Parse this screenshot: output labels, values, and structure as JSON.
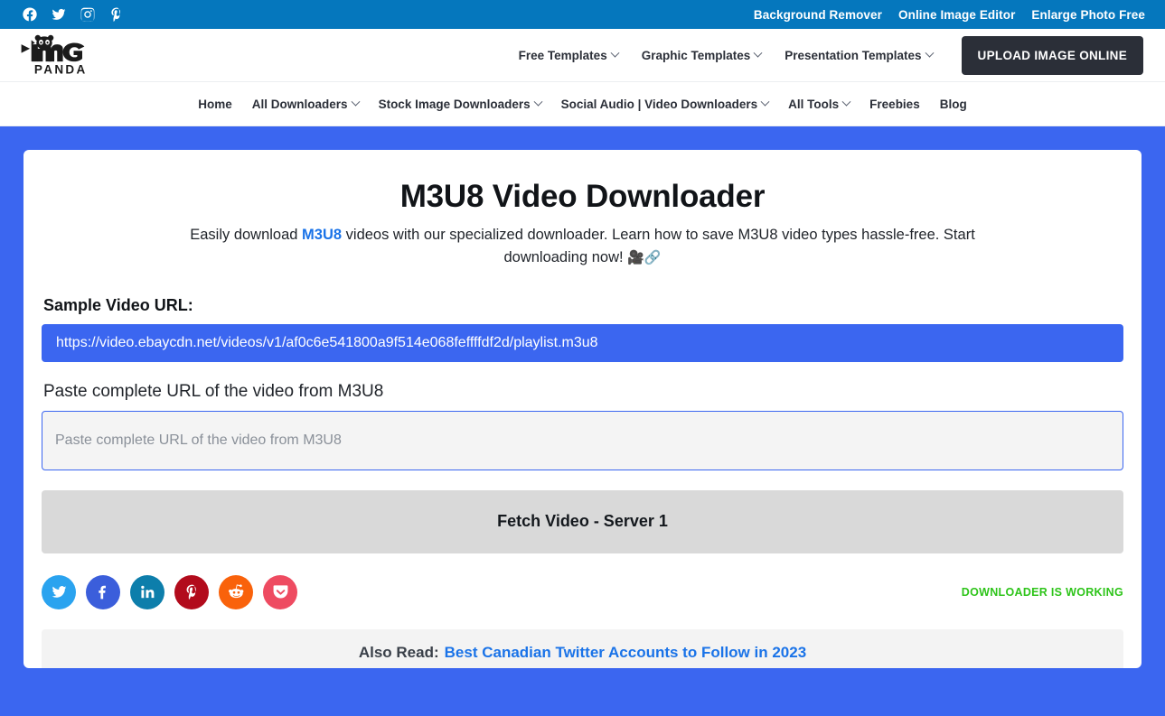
{
  "topbar": {
    "social_icons": [
      {
        "name": "facebook-icon",
        "label": "Facebook"
      },
      {
        "name": "twitter-icon",
        "label": "Twitter"
      },
      {
        "name": "instagram-icon",
        "label": "Instagram"
      },
      {
        "name": "pinterest-icon",
        "label": "Pinterest"
      }
    ],
    "links": [
      {
        "label": "Background Remover"
      },
      {
        "label": "Online Image Editor"
      },
      {
        "label": "Enlarge Photo Free"
      }
    ],
    "bg_color": "#0577BD"
  },
  "header": {
    "logo_text": "IMG PANDA",
    "nav": [
      {
        "label": "Free Templates",
        "has_caret": true
      },
      {
        "label": "Graphic Templates",
        "has_caret": true
      },
      {
        "label": "Presentation Templates",
        "has_caret": true
      }
    ],
    "upload_button": "UPLOAD IMAGE ONLINE"
  },
  "subnav": {
    "items": [
      {
        "label": "Home",
        "has_caret": false
      },
      {
        "label": "All Downloaders",
        "has_caret": true
      },
      {
        "label": "Stock Image Downloaders",
        "has_caret": true
      },
      {
        "label": "Social Audio | Video Downloaders",
        "has_caret": true
      },
      {
        "label": "All Tools",
        "has_caret": true
      },
      {
        "label": "Freebies",
        "has_caret": false
      },
      {
        "label": "Blog",
        "has_caret": false
      }
    ]
  },
  "main": {
    "title": "M3U8 Video Downloader",
    "subtitle_part1": "Easily download ",
    "subtitle_highlight": "M3U8",
    "subtitle_part2": " videos with our specialized downloader. Learn how to save M3U8 video types hassle-free. Start downloading now! ",
    "subtitle_emoji": "🎥🔗",
    "sample_label": "Sample Video URL:",
    "sample_url": "https://video.ebaycdn.net/videos/v1/af0c6e541800a9f514e068feffffdf2d/playlist.m3u8",
    "paste_label": "Paste complete URL of the video from M3U8",
    "input_placeholder": "Paste complete URL of the video from M3U8",
    "input_value": "",
    "fetch_button": "Fetch Video - Server 1",
    "status_text": "DOWNLOADER IS WORKING",
    "status_color": "#2EC41A",
    "also_read_label": "Also Read:",
    "also_read_link": "Best Canadian Twitter Accounts to Follow in 2023",
    "canvas_color": "#3B66F0",
    "sample_url_bg": "#3B66F0",
    "fetch_button_bg": "#D9D9D9"
  },
  "share": {
    "icons": [
      {
        "name": "twitter-share-icon",
        "label": "Twitter",
        "color": "#2AA3EF"
      },
      {
        "name": "facebook-share-icon",
        "label": "Facebook",
        "color": "#3B5EDB"
      },
      {
        "name": "linkedin-share-icon",
        "label": "LinkedIn",
        "color": "#0D7EAB"
      },
      {
        "name": "pinterest-share-icon",
        "label": "Pinterest",
        "color": "#B20B1C"
      },
      {
        "name": "reddit-share-icon",
        "label": "Reddit",
        "color": "#F9620B"
      },
      {
        "name": "pocket-share-icon",
        "label": "Pocket",
        "color": "#EE4B61"
      }
    ]
  }
}
